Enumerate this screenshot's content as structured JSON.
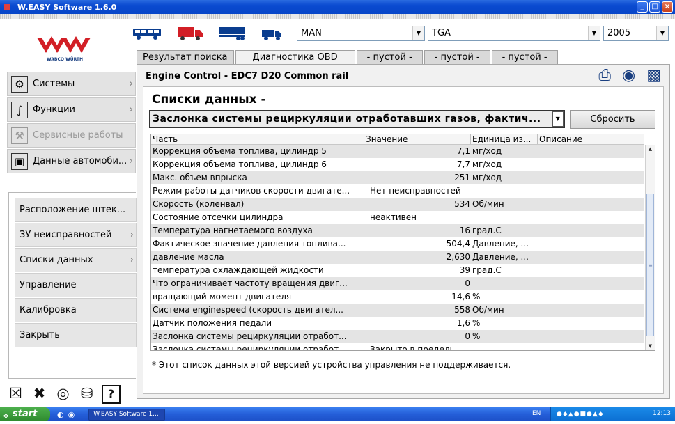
{
  "window": {
    "title": "W.EASY Software 1.6.0"
  },
  "logo": {
    "brand": "WABCO WÜRTH"
  },
  "vehicle": {
    "make": "MAN",
    "model": "TGA",
    "year": "2005"
  },
  "tabs": [
    "Результат поиска",
    "Диагностика OBD",
    "- пустой -",
    "- пустой -",
    "- пустой -"
  ],
  "nav": {
    "systems": "Системы",
    "functions": "Функции",
    "service": "Сервисные работы",
    "vehicle_data": "Данные автомоби..."
  },
  "subnav": {
    "connector": "Расположение штек...",
    "faults": "ЗУ неисправностей",
    "datalists": "Списки данных",
    "control": "Управление",
    "calibration": "Калибровка",
    "close": "Закрыть"
  },
  "main": {
    "ecu_title": "Engine Control - EDC7 D20 Common rail",
    "section_title": "Списки данных -",
    "dropdown_value": "Заслонка системы рециркуляции отработавших газов, фактич...",
    "reset_label": "Сбросить",
    "footnote": "* Этот список данных этой версией устройства управления не поддерживается."
  },
  "table": {
    "headers": [
      "Часть",
      "Значение",
      "Единица из...",
      "Описание"
    ],
    "rows": [
      {
        "part": "Коррекция объема топлива, цилиндр 5",
        "value": "7,1",
        "unit": "мг/ход"
      },
      {
        "part": "Коррекция объема топлива, цилиндр 6",
        "value": "7,7",
        "unit": "мг/ход"
      },
      {
        "part": "Макс. объем впрыска",
        "value": "251",
        "unit": "мг/ход"
      },
      {
        "part": "Режим работы датчиков скорости двигате...",
        "value": "Нет неисправностей",
        "unit": ""
      },
      {
        "part": "Скорость (коленвал)",
        "value": "534",
        "unit": "Об/мин"
      },
      {
        "part": "Состояние отсечки цилиндра",
        "value": "неактивен",
        "unit": ""
      },
      {
        "part": "Температура нагнетаемого воздуха",
        "value": "16",
        "unit": "град.С"
      },
      {
        "part": "Фактическое значение давления топлива...",
        "value": "504,4",
        "unit": "Давление, ..."
      },
      {
        "part": "давление масла",
        "value": "2,630",
        "unit": "Давление, ..."
      },
      {
        "part": "температура охлаждающей жидкости",
        "value": "39",
        "unit": "град.С"
      },
      {
        "part": "Что ограничивает частоту вращения двиг...",
        "value": "0",
        "unit": ""
      },
      {
        "part": "вращающий момент двигателя",
        "value": "14,6",
        "unit": "%"
      },
      {
        "part": "Система enginespeed (скорость двигател...",
        "value": "558",
        "unit": "Об/мин"
      },
      {
        "part": "Датчик положения педали",
        "value": "1,6",
        "unit": "%"
      },
      {
        "part": "Заслонка системы рециркуляции отработ...",
        "value": "0",
        "unit": "%"
      },
      {
        "part": "Заслонка системы рециркуляции отработ...",
        "value": "Закрыто в предель...",
        "unit": ""
      }
    ]
  },
  "taskbar": {
    "start": "start",
    "task": "W.EASY Software 1...",
    "lang": "EN",
    "clock": "12:13"
  }
}
